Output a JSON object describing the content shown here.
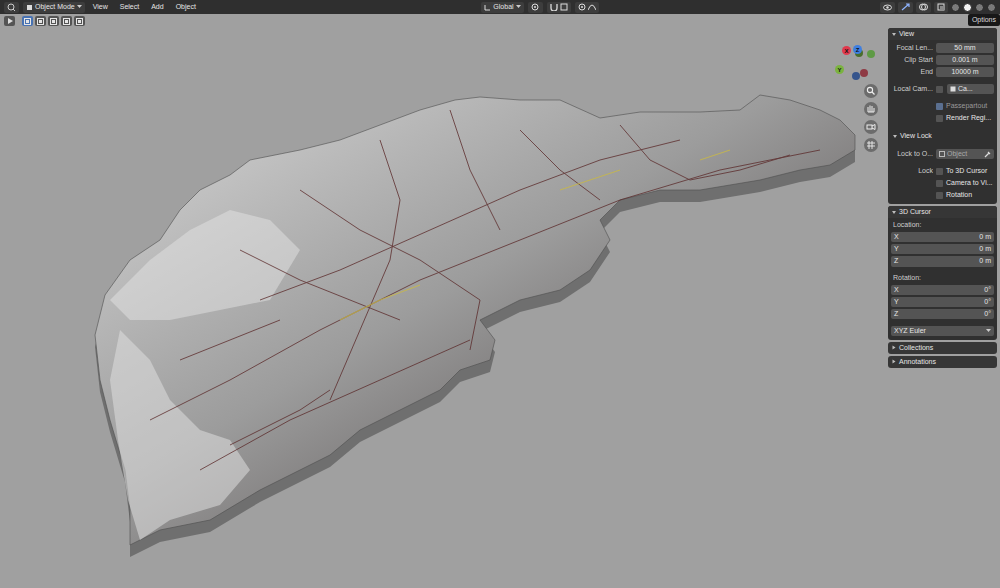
{
  "header": {
    "mode": "Object Mode",
    "menus": [
      "View",
      "Select",
      "Add",
      "Object"
    ],
    "orientation": "Global",
    "shading_modes": [
      {
        "selected": false
      },
      {
        "selected": true
      },
      {
        "selected": false
      },
      {
        "selected": false
      }
    ]
  },
  "tooltip": "Options",
  "select_modes": [
    {
      "selected": true
    },
    {
      "selected": false
    },
    {
      "selected": false
    },
    {
      "selected": false
    },
    {
      "selected": false
    }
  ],
  "gizmo": {
    "axes": [
      {
        "label": "X",
        "color": "#e0394d"
      },
      {
        "label": "Y",
        "color": "#7bb33f"
      },
      {
        "label": "Z",
        "color": "#3f7fe0"
      }
    ]
  },
  "panel": {
    "sections": [
      {
        "title": "View",
        "expanded": true,
        "rows": [
          {
            "kind": "field",
            "label": "Focal Len...",
            "value": "50 mm"
          },
          {
            "kind": "field",
            "label": "Clip Start",
            "value": "0.001 m"
          },
          {
            "kind": "field",
            "label": "End",
            "value": "10000 m"
          },
          {
            "kind": "camera",
            "label": "Local Cam...",
            "checked": false,
            "value": "Ca..."
          },
          {
            "kind": "check",
            "label": "Passepartout",
            "lead": "",
            "checked": true,
            "disabled": true
          },
          {
            "kind": "check",
            "label": "Render Regi...",
            "lead": "",
            "checked": false,
            "disabled": false
          },
          {
            "kind": "subpanel",
            "title": "View Lock",
            "expanded": true
          },
          {
            "kind": "picker",
            "label": "Lock to O...",
            "placeholder": "Object"
          },
          {
            "kind": "check",
            "label": "To 3D Cursor",
            "lead": "Lock",
            "checked": false,
            "disabled": false
          },
          {
            "kind": "check",
            "label": "Camera to Vi...",
            "lead": "",
            "checked": false,
            "disabled": false
          },
          {
            "kind": "check",
            "label": "Rotation",
            "lead": "",
            "checked": false,
            "disabled": false
          }
        ]
      },
      {
        "title": "3D Cursor",
        "expanded": true,
        "rows": [
          {
            "kind": "caption",
            "label": "Location:"
          },
          {
            "kind": "axis",
            "label": "X",
            "value": "0 m"
          },
          {
            "kind": "axis",
            "label": "Y",
            "value": "0 m"
          },
          {
            "kind": "axis",
            "label": "Z",
            "value": "0 m"
          },
          {
            "kind": "caption",
            "label": "Rotation:"
          },
          {
            "kind": "axis",
            "label": "X",
            "value": "0°"
          },
          {
            "kind": "axis",
            "label": "Y",
            "value": "0°"
          },
          {
            "kind": "axis",
            "label": "Z",
            "value": "0°"
          },
          {
            "kind": "dropdown",
            "value": "XYZ Euler"
          }
        ]
      },
      {
        "title": "Collections",
        "expanded": false,
        "rows": []
      },
      {
        "title": "Annotations",
        "expanded": false,
        "rows": []
      }
    ]
  }
}
